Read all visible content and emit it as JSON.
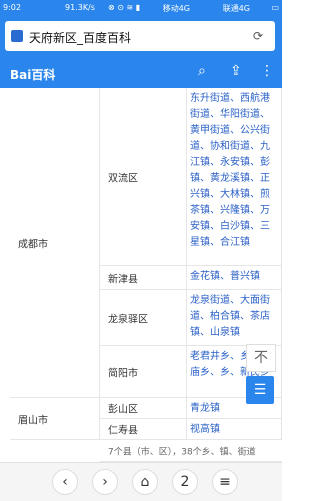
{
  "status": {
    "time": "9:02",
    "speed": "91.3K/s",
    "icons": "⊗ ⊙ ≋ ▮",
    "carrier1": "移动4G",
    "carrier2": "联通4G",
    "battery": "▭"
  },
  "urlbar": {
    "title": "天府新区_百度百科",
    "reload_icon": "⟳"
  },
  "header": {
    "logo": "Bai百科",
    "search_icon": "⌕",
    "share_icon": "⇪",
    "more_icon": "⋮"
  },
  "rows": [
    {
      "city": "成都市",
      "districts": [
        {
          "district": "双流区",
          "towns": "东升街道、西航港街道、华阳街道、黄甲街道、公兴街道、协和街道、九江镇、永安镇、彭镇、黄龙溪镇、正兴镇、大林镇、煎茶镇、兴隆镇、万安镇、白沙镇、三星镇、合江镇"
        },
        {
          "district": "新津县",
          "towns": "金花镇、普兴镇"
        },
        {
          "district": "龙泉驿区",
          "towns": "龙泉街道、大面街道、柏合镇、茶店镇、山泉镇"
        },
        {
          "district": "简阳市",
          "towns": "老君井乡、乡、武庙乡、乡、新民乡"
        }
      ]
    },
    {
      "city": "眉山市",
      "districts": [
        {
          "district": "彭山区",
          "towns": "青龙镇"
        },
        {
          "district": "仁寿县",
          "towns": "视高镇"
        }
      ]
    }
  ],
  "footer_text": "7个县（市、区），38个乡、镇、街道",
  "float_up_icon": "不",
  "float_menu_icon": "☰",
  "bottom": {
    "back": "‹",
    "forward": "›",
    "home": "⌂",
    "tabs": "2",
    "menu": "≡"
  }
}
